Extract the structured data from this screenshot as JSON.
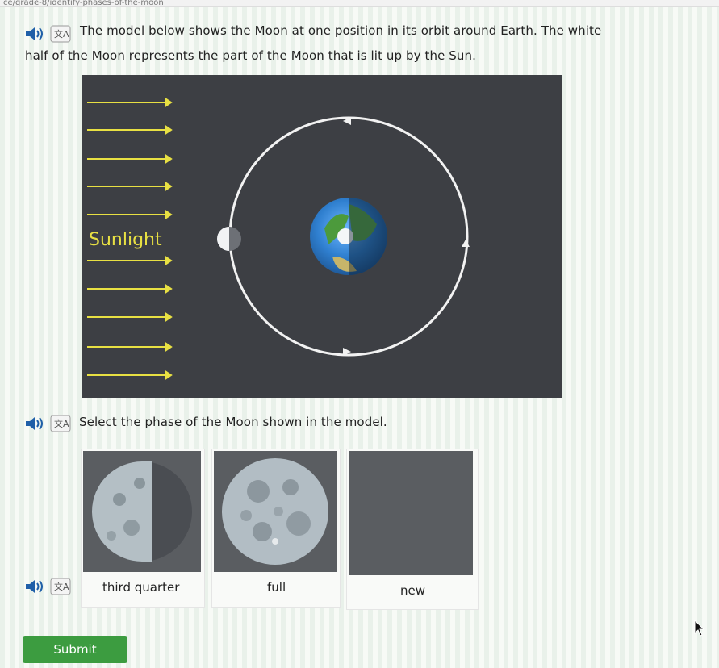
{
  "url": "ce/grade-8/identify-phases-of-the-moon",
  "question": {
    "line1": "The model below shows the Moon at one position in its orbit around Earth. The white",
    "line2": "half of the Moon represents the part of the Moon that is lit up by the Sun."
  },
  "model": {
    "sunlight_label": "Sunlight"
  },
  "prompt": "Select the phase of the Moon shown in the model.",
  "choices": [
    {
      "label": "third quarter",
      "phase": "third-quarter"
    },
    {
      "label": "full",
      "phase": "full"
    },
    {
      "label": "new",
      "phase": "new"
    }
  ],
  "submit_label": "Submit",
  "colors": {
    "panel": "#3d3f44",
    "arrow": "#e8e043",
    "submit": "#3c9c40"
  }
}
